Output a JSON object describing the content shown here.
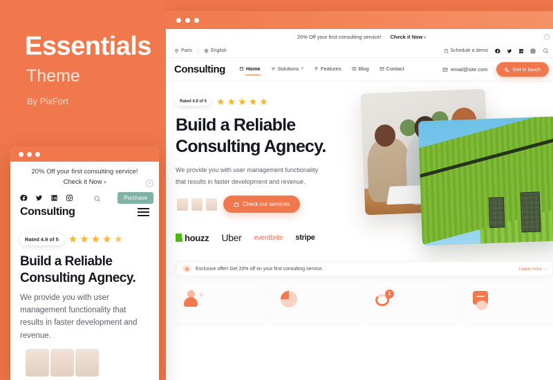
{
  "promo": {
    "title": "Essentials",
    "subtitle": "Theme",
    "byline": "By PixFort",
    "bg_color": "#f0784c"
  },
  "phone": {
    "announcement": "20% Off your first consulting service!",
    "announcement_cta": "Check it Now ›",
    "close_icon": "×",
    "socials": [
      "facebook-icon",
      "twitter-icon",
      "linkedin-icon",
      "instagram-icon"
    ],
    "search_icon": "search-icon",
    "purchase_label": "Purchase",
    "brand": "Consulting",
    "menu_icon": "hamburger-icon",
    "rating_label": "Rated 4.9 of 5",
    "stars": 5,
    "heading": "Build a Reliable Consulting Agnecy.",
    "paragraph": "We provide you with user management functionality that results in faster development and revenue."
  },
  "browser": {
    "dots": 3,
    "announcement": {
      "text": "20% Off your first consulting service!",
      "cta": "Check it Now ›",
      "close_icon": "×"
    },
    "utility": {
      "location": "Paris",
      "language": "English",
      "schedule": "Schedule a demo",
      "socials": [
        "facebook-icon",
        "twitter-icon",
        "linkedin-icon",
        "instagram-icon"
      ],
      "search_icon": "search-icon"
    },
    "nav": {
      "brand": "Consulting",
      "links": [
        {
          "label": "Home",
          "icon": "home-icon",
          "active": true
        },
        {
          "label": "Solutions",
          "icon": "list-icon",
          "caret": "˅",
          "active": false
        },
        {
          "label": "Features",
          "icon": "trophy-icon",
          "active": false
        },
        {
          "label": "Blog",
          "icon": "news-icon",
          "active": false
        },
        {
          "label": "Contact",
          "icon": "mail-icon",
          "active": false
        }
      ],
      "email": "email@site.com",
      "cta": "Get in touch",
      "cta_icon": "phone-icon"
    },
    "hero": {
      "rating_label": "Rated 4.9 of 5",
      "stars": 5,
      "heading_line1": "Build a Reliable",
      "heading_line2": "Consulting Agnecy.",
      "paragraph_line1": "We provide you with user management functionality",
      "paragraph_line2": "that results in faster development and revenue.",
      "button": "Check our services",
      "button_icon": "briefcase-icon",
      "logos": [
        {
          "name": "houzz",
          "label": "houzz",
          "color": "#1b1b1b"
        },
        {
          "name": "uber",
          "label": "Uber",
          "color": "#1b1b1b"
        },
        {
          "name": "eventbrite",
          "label": "eventbrite",
          "color": "#f0684c"
        },
        {
          "name": "stripe",
          "label": "stripe",
          "color": "#1b1b1b"
        }
      ]
    },
    "offer": {
      "text": "Exclusive offer! Get 20% off on your first consulting service.",
      "link": "Learn more",
      "link_arrow": "›"
    },
    "cards": [
      {
        "icon": "add-user-icon",
        "badge": ""
      },
      {
        "icon": "pie-chart-icon",
        "badge": ""
      },
      {
        "icon": "notification-bell-icon",
        "badge": "1"
      },
      {
        "icon": "note-card-icon",
        "badge": ""
      }
    ]
  },
  "colors": {
    "accent": "#f0784c",
    "accent_light": "#fbd3c3",
    "star": "#f7b32b",
    "green": "#4dbc15",
    "teal": "#6fa89a",
    "dark": "#141820",
    "muted": "#5b6068"
  }
}
